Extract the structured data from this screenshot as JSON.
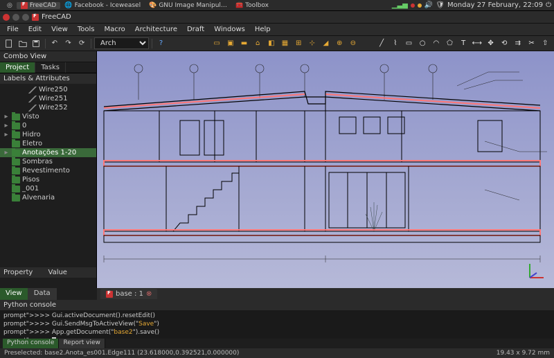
{
  "taskbar": {
    "items": [
      {
        "label": "FreeCAD",
        "active": true
      },
      {
        "label": "Facebook - Iceweasel",
        "active": false
      },
      {
        "label": "GNU Image Manipul…",
        "active": false
      },
      {
        "label": "Toolbox",
        "active": false
      }
    ],
    "clock": "Monday 27 February, 22:09"
  },
  "window": {
    "title": "FreeCAD"
  },
  "menu": [
    "File",
    "Edit",
    "View",
    "Tools",
    "Macro",
    "Architecture",
    "Draft",
    "Windows",
    "Help"
  ],
  "workbench": {
    "selected": "Arch"
  },
  "combo": {
    "title": "Combo View",
    "tabs": [
      "Project",
      "Tasks"
    ],
    "active_tab": 0,
    "tree_header": "Labels & Attributes",
    "items": [
      {
        "indent": 2,
        "icon": "line",
        "label": "Wire250"
      },
      {
        "indent": 2,
        "icon": "line",
        "label": "Wire251"
      },
      {
        "indent": 2,
        "icon": "line",
        "label": "Wire252"
      },
      {
        "indent": 0,
        "icon": "folder",
        "arrow": "▸",
        "label": "Visto"
      },
      {
        "indent": 0,
        "icon": "folder",
        "arrow": "▸",
        "label": "0"
      },
      {
        "indent": 0,
        "icon": "folder",
        "arrow": "▸",
        "label": "Hidro"
      },
      {
        "indent": 0,
        "icon": "folder",
        "label": "Eletro"
      },
      {
        "indent": 0,
        "icon": "folder",
        "arrow": "▸",
        "label": "Anotações 1-20",
        "sel": true
      },
      {
        "indent": 0,
        "icon": "folder",
        "label": "Sombras"
      },
      {
        "indent": 0,
        "icon": "folder",
        "label": "Revestimento"
      },
      {
        "indent": 0,
        "icon": "folder",
        "label": "Pisos"
      },
      {
        "indent": 0,
        "icon": "folder",
        "label": "_001"
      },
      {
        "indent": 0,
        "icon": "folder",
        "label": "Alvenaria"
      }
    ],
    "prop_cols": [
      "Property",
      "Value"
    ],
    "bottom_tabs": [
      "View",
      "Data"
    ]
  },
  "viewport": {
    "doc_tab": "base : 1"
  },
  "console": {
    "title": "Python console",
    "lines": [
      ">>> Gui.activeDocument().resetEdit()",
      ">>> Gui.SendMsgToActiveView(\"Save\")",
      ">>> App.getDocument(\"base2\").save()",
      ">>> "
    ],
    "tabs": [
      "Python console",
      "Report view"
    ]
  },
  "status": {
    "left": "Preselected: base2.Anota_es001.Edge111 (23.618000,0.392521,0.000000)",
    "right": "19.43 x 9.72 mm"
  },
  "colors": {
    "accent": "#e6a934",
    "sel": "#3a6a3a"
  }
}
